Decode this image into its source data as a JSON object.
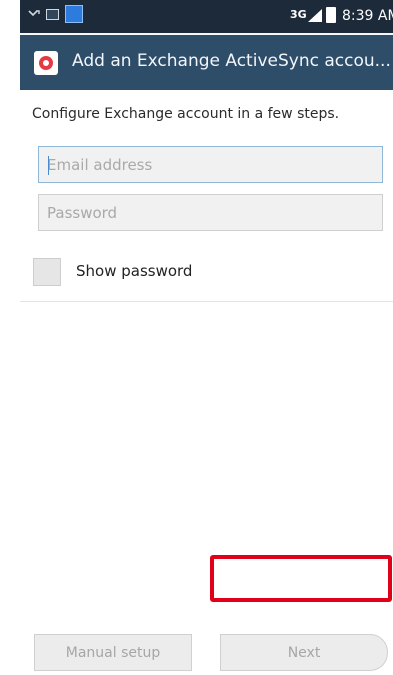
{
  "status_bar": {
    "time": "8:39 AM",
    "network_label": "3G",
    "icons": [
      "missed-call-icon",
      "image-icon",
      "email-notification-icon",
      "3g-icon",
      "signal-icon",
      "battery-icon"
    ]
  },
  "title_bar": {
    "title": "Add an Exchange ActiveSync accou...",
    "icon": "exchange-activesync-icon",
    "background": "#2e4d69"
  },
  "form": {
    "instruction": "Configure Exchange account in a few steps.",
    "email": {
      "placeholder": "Email address",
      "value": ""
    },
    "password": {
      "placeholder": "Password",
      "value": ""
    },
    "show_password": {
      "label": "Show password",
      "checked": false
    }
  },
  "buttons": {
    "manual_setup": "Manual setup",
    "next": "Next"
  },
  "colors": {
    "highlight": "#e0001a",
    "status_bar": "#1c2a3a"
  }
}
